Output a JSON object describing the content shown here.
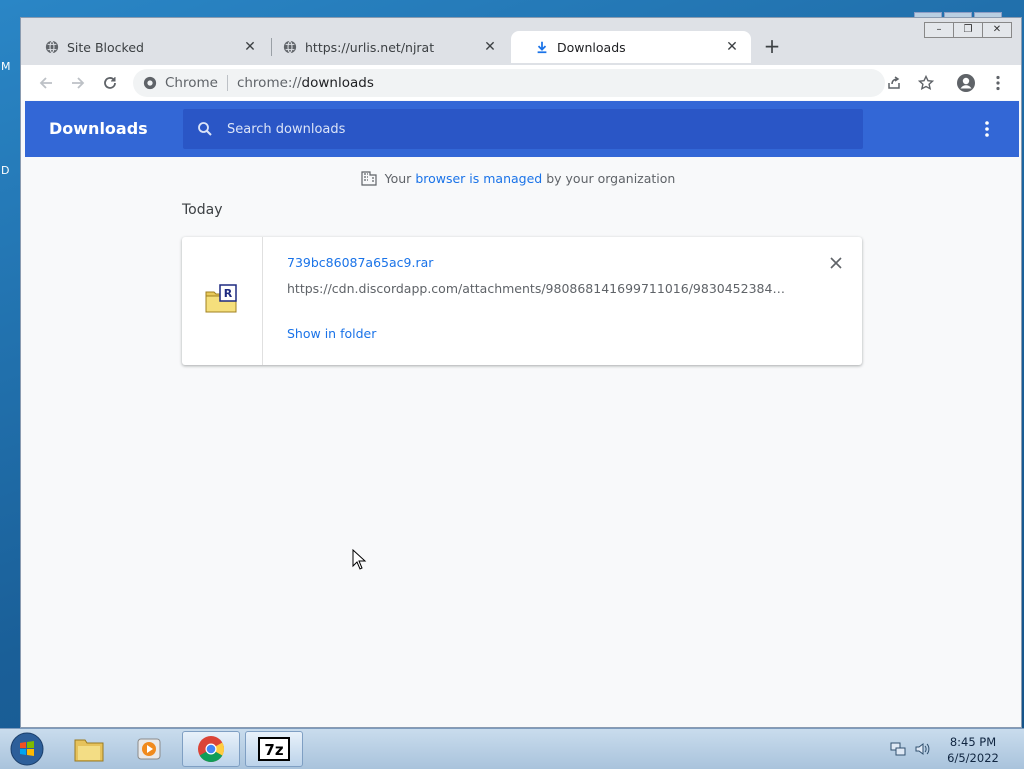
{
  "desktop": {
    "edge_fragments": [
      "M",
      "D"
    ]
  },
  "tabs": [
    {
      "label": "Site Blocked",
      "icon": "globe-icon",
      "active": false
    },
    {
      "label": "https://urlis.net/njrat",
      "icon": "globe-icon",
      "active": false
    },
    {
      "label": "Downloads",
      "icon": "download-icon",
      "active": true
    }
  ],
  "toolbar": {
    "site_chip": "Chrome",
    "url_scheme": "chrome://",
    "url_host": "downloads"
  },
  "downloads_page": {
    "title": "Downloads",
    "search_placeholder": "Search downloads",
    "managed_prefix": "Your ",
    "managed_link": "browser is managed",
    "managed_suffix": " by your organization",
    "date_label": "Today",
    "items": [
      {
        "filename": "739bc86087a65ac9.rar",
        "url": "https://cdn.discordapp.com/attachments/980868141699711016/98304523840902…",
        "action": "Show in folder",
        "file_icon": "winrar-archive-icon"
      }
    ]
  },
  "taskbar": {
    "items": [
      "start-button",
      "explorer",
      "media-player",
      "chrome",
      "7zip"
    ],
    "time": "8:45 PM",
    "date": "6/5/2022"
  },
  "colors": {
    "header_blue": "#3367d6",
    "search_blue": "#2a56c6",
    "link_blue": "#1a73e8"
  }
}
